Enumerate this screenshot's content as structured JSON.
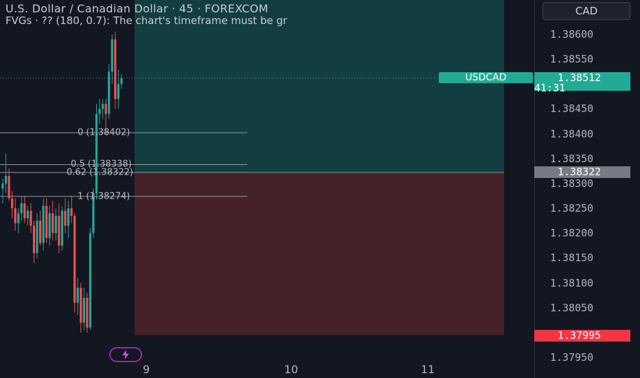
{
  "header": {
    "title": "U.S. Dollar / Canadian Dollar · 45 · FOREXCOM",
    "indicator": "FVGs · ?? (180, 0.7): The chart's timeframe must be gr"
  },
  "price_axis": {
    "currency": "CAD",
    "ticks": [
      "1.38600",
      "1.38550",
      "1.38450",
      "1.38400",
      "1.38350",
      "1.38300",
      "1.38250",
      "1.38200",
      "1.38150",
      "1.38100",
      "1.38050",
      "1.37950"
    ]
  },
  "badges": {
    "symbol": "USDCAD",
    "current_price": "1.38512",
    "countdown": "41:31",
    "level_price": "1.38322",
    "stop_price": "1.37995"
  },
  "fib_levels": [
    {
      "label": "0 (1.38402)",
      "price": 1.38402
    },
    {
      "label": "0.5 (1.38338)",
      "price": 1.38338
    },
    {
      "label": "0.62 (1.38322)",
      "price": 1.38322
    },
    {
      "label": "1 (1.38274)",
      "price": 1.38274
    }
  ],
  "time_axis": [
    "9",
    "10",
    "11"
  ],
  "colors": {
    "background": "#131722",
    "up": "#26a69a",
    "down": "#ef5350",
    "profit_zone": "#134548",
    "loss_zone": "#4a2329",
    "badge_green": "#22ab94",
    "badge_gray": "#787b86",
    "badge_red": "#f23645",
    "replay": "#9c27b0"
  },
  "position_tool": {
    "target": 1.38685,
    "entry": 1.38322,
    "stop": 1.37995
  },
  "chart_data": {
    "type": "candlestick",
    "ylim": [
      1.3793,
      1.3869
    ],
    "candles": [
      {
        "o": 1.3829,
        "h": 1.3831,
        "l": 1.3826,
        "c": 1.383
      },
      {
        "o": 1.383,
        "h": 1.3836,
        "l": 1.3828,
        "c": 1.38315
      },
      {
        "o": 1.38315,
        "h": 1.3833,
        "l": 1.38265,
        "c": 1.3827
      },
      {
        "o": 1.3827,
        "h": 1.38285,
        "l": 1.3823,
        "c": 1.3825
      },
      {
        "o": 1.3825,
        "h": 1.3827,
        "l": 1.38205,
        "c": 1.3822
      },
      {
        "o": 1.3822,
        "h": 1.3825,
        "l": 1.382,
        "c": 1.3824
      },
      {
        "o": 1.3824,
        "h": 1.38275,
        "l": 1.38225,
        "c": 1.3826
      },
      {
        "o": 1.3826,
        "h": 1.38275,
        "l": 1.3822,
        "c": 1.3823
      },
      {
        "o": 1.3823,
        "h": 1.38255,
        "l": 1.38215,
        "c": 1.38245
      },
      {
        "o": 1.38245,
        "h": 1.3826,
        "l": 1.382,
        "c": 1.38215
      },
      {
        "o": 1.38215,
        "h": 1.38225,
        "l": 1.3814,
        "c": 1.3816
      },
      {
        "o": 1.3816,
        "h": 1.3824,
        "l": 1.3815,
        "c": 1.38225
      },
      {
        "o": 1.38225,
        "h": 1.38245,
        "l": 1.38175,
        "c": 1.3818
      },
      {
        "o": 1.3818,
        "h": 1.3827,
        "l": 1.38165,
        "c": 1.38255
      },
      {
        "o": 1.38255,
        "h": 1.3827,
        "l": 1.3818,
        "c": 1.3819
      },
      {
        "o": 1.3819,
        "h": 1.38255,
        "l": 1.38175,
        "c": 1.3824
      },
      {
        "o": 1.3824,
        "h": 1.38265,
        "l": 1.38185,
        "c": 1.382
      },
      {
        "o": 1.382,
        "h": 1.3825,
        "l": 1.38185,
        "c": 1.38235
      },
      {
        "o": 1.38235,
        "h": 1.3826,
        "l": 1.3816,
        "c": 1.38175
      },
      {
        "o": 1.38175,
        "h": 1.38255,
        "l": 1.38165,
        "c": 1.38245
      },
      {
        "o": 1.38245,
        "h": 1.3827,
        "l": 1.382,
        "c": 1.38215
      },
      {
        "o": 1.38215,
        "h": 1.38265,
        "l": 1.3819,
        "c": 1.3825
      },
      {
        "o": 1.3825,
        "h": 1.38275,
        "l": 1.3822,
        "c": 1.38235
      },
      {
        "o": 1.38235,
        "h": 1.3824,
        "l": 1.3804,
        "c": 1.3806
      },
      {
        "o": 1.3806,
        "h": 1.3811,
        "l": 1.38035,
        "c": 1.3809
      },
      {
        "o": 1.3809,
        "h": 1.381,
        "l": 1.38,
        "c": 1.3802
      },
      {
        "o": 1.3802,
        "h": 1.3809,
        "l": 1.38005,
        "c": 1.3807
      },
      {
        "o": 1.3807,
        "h": 1.3808,
        "l": 1.38,
        "c": 1.3801
      },
      {
        "o": 1.3801,
        "h": 1.3821,
        "l": 1.38005,
        "c": 1.382
      },
      {
        "o": 1.382,
        "h": 1.3829,
        "l": 1.3819,
        "c": 1.3828
      },
      {
        "o": 1.3828,
        "h": 1.3846,
        "l": 1.3827,
        "c": 1.3844
      },
      {
        "o": 1.3844,
        "h": 1.3847,
        "l": 1.3842,
        "c": 1.3845
      },
      {
        "o": 1.3845,
        "h": 1.3847,
        "l": 1.3843,
        "c": 1.3846
      },
      {
        "o": 1.3846,
        "h": 1.3847,
        "l": 1.384,
        "c": 1.3844
      },
      {
        "o": 1.3844,
        "h": 1.3854,
        "l": 1.3843,
        "c": 1.38525
      },
      {
        "o": 1.38525,
        "h": 1.386,
        "l": 1.385,
        "c": 1.3859
      },
      {
        "o": 1.3859,
        "h": 1.38605,
        "l": 1.3845,
        "c": 1.3847
      },
      {
        "o": 1.3847,
        "h": 1.3853,
        "l": 1.3845,
        "c": 1.385
      },
      {
        "o": 1.385,
        "h": 1.3852,
        "l": 1.3849,
        "c": 1.38512
      }
    ]
  }
}
